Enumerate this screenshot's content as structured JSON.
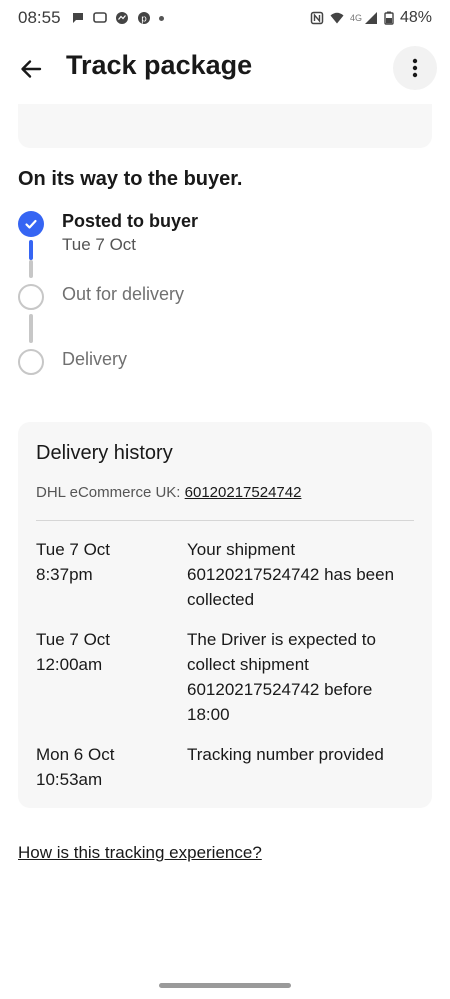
{
  "status_bar": {
    "time": "08:55",
    "network": "4G",
    "battery": "48%"
  },
  "app_bar": {
    "title": "Track package"
  },
  "tracking": {
    "status_heading": "On its way to the buyer.",
    "steps": [
      {
        "label": "Posted to buyer",
        "date": "Tue 7 Oct",
        "state": "done"
      },
      {
        "label": "Out for delivery",
        "state": "pending"
      },
      {
        "label": "Delivery",
        "state": "pending"
      }
    ]
  },
  "history": {
    "title": "Delivery history",
    "carrier_label": "DHL eCommerce UK:",
    "tracking_number": "60120217524742",
    "events": [
      {
        "date": "Tue 7 Oct",
        "time": "8:37pm",
        "description": "Your shipment 60120217524742 has been collected"
      },
      {
        "date": "Tue 7 Oct",
        "time": "12:00am",
        "description": "The Driver is expected to collect shipment 60120217524742 before 18:00"
      },
      {
        "date": "Mon 6 Oct",
        "time": "10:53am",
        "description": "Tracking number provided"
      }
    ]
  },
  "feedback": {
    "label": "How is this tracking experience?"
  },
  "colors": {
    "accent": "#3665f3",
    "card_bg": "#f7f7f7",
    "inactive": "#c7c7c7"
  }
}
